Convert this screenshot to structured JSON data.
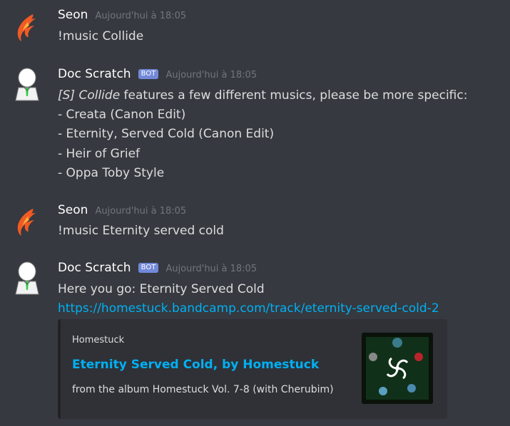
{
  "messages": [
    {
      "author": "Seon",
      "timestamp": "Aujourd'hui à 18:05",
      "lines": [
        "!music Collide"
      ]
    },
    {
      "author": "Doc Scratch",
      "bot_tag": "BOT",
      "timestamp": "Aujourd'hui à 18:05",
      "intro_italic": "[S] Collide",
      "intro_rest": " features a few different musics, please be more specific:",
      "lines": [
        "- Creata (Canon Edit)",
        "- Eternity, Served Cold (Canon Edit)",
        "- Heir of Grief",
        "- Oppa Toby Style"
      ]
    },
    {
      "author": "Seon",
      "timestamp": "Aujourd'hui à 18:05",
      "lines": [
        "!music Eternity served cold"
      ]
    },
    {
      "author": "Doc Scratch",
      "bot_tag": "BOT",
      "timestamp": "Aujourd'hui à 18:05",
      "lines": [
        "Here you go: Eternity Served Cold"
      ],
      "link": "https://homestuck.bandcamp.com/track/eternity-served-cold-2",
      "embed": {
        "provider": "Homestuck",
        "title": "Eternity Served Cold, by Homestuck",
        "description": "from the album Homestuck Vol. 7-8 (with Cherubim)"
      }
    }
  ],
  "colors": {
    "background": "#36393f",
    "link": "#00b0f4",
    "bot_tag": "#7289da",
    "timestamp": "#72767d",
    "embed_bg": "#2f3136"
  }
}
